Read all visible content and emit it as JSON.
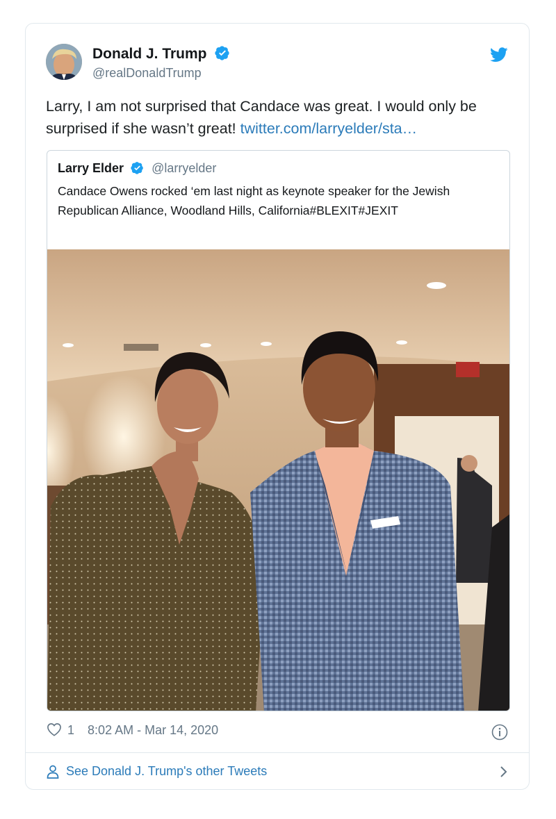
{
  "tweet": {
    "author_name": "Donald J. Trump",
    "author_handle": "@realDonaldTrump",
    "text": "Larry, I am not surprised that Candace was great. I would only be surprised if she wasn’t great! ",
    "link": "twitter.com/larryelder/sta…",
    "likes": "1",
    "timestamp": "8:02 AM - Mar 14, 2020"
  },
  "quoted": {
    "author_name": "Larry Elder",
    "author_handle": "@larryelder",
    "text": "Candace Owens rocked ‘em last night as keynote speaker for the Jewish Republican Alliance, Woodland Hills, California#BLEXIT#JEXIT"
  },
  "footer": {
    "label": "See Donald J. Trump's other Tweets"
  },
  "icons": {
    "verified": "verified-badge-icon",
    "bird": "twitter-bird-icon",
    "heart": "heart-icon",
    "info": "info-icon",
    "person": "person-icon",
    "chevron": "chevron-right-icon"
  },
  "colors": {
    "accent": "#1da1f2",
    "link": "#2b7bb9",
    "muted": "#657786",
    "border": "#e1e8ed"
  }
}
